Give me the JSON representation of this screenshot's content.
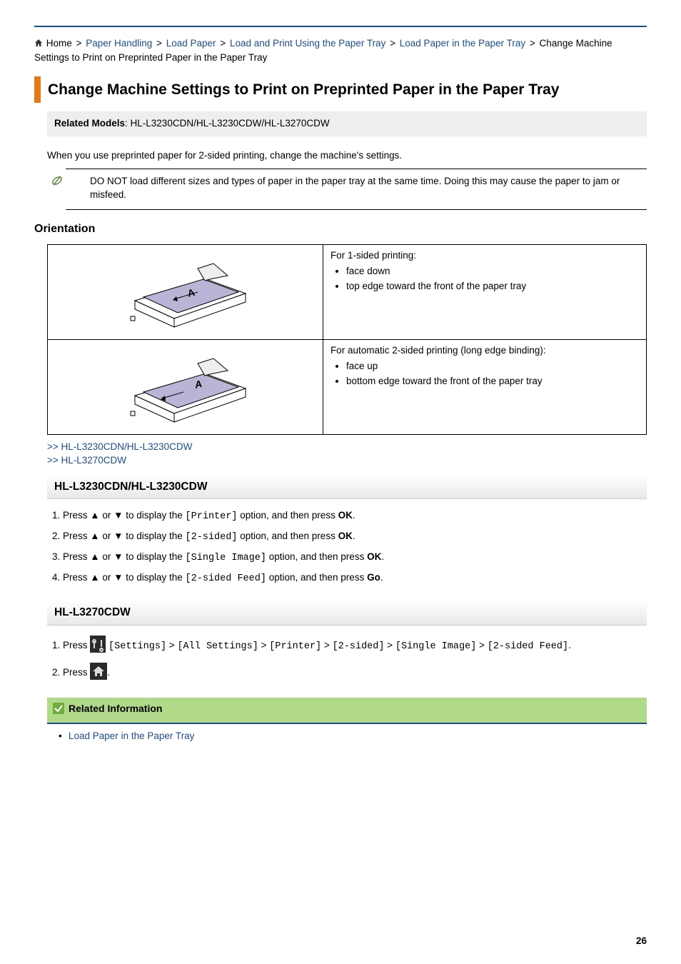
{
  "breadcrumb": {
    "home": "Home",
    "items": [
      "Paper Handling",
      "Load Paper",
      "Load and Print Using the Paper Tray",
      "Load Paper in the Paper Tray"
    ],
    "current": "Change Machine Settings to Print on Preprinted Paper in the Paper Tray"
  },
  "title": "Change Machine Settings to Print on Preprinted Paper in the Paper Tray",
  "related_models": {
    "label": "Related Models",
    "value": ": HL-L3230CDN/HL-L3230CDW/HL-L3270CDW"
  },
  "intro": "When you use preprinted paper for 2-sided printing, change the machine's settings.",
  "note": "DO NOT load different sizes and types of paper in the paper tray at the same time. Doing this may cause the paper to jam or misfeed.",
  "orientation": {
    "heading": "Orientation",
    "row1": {
      "lead": "For 1-sided printing:",
      "b1": "face down",
      "b2": "top edge toward the front of the paper tray"
    },
    "row2": {
      "lead": "For automatic 2-sided printing (long edge binding):",
      "b1": "face up",
      "b2": "bottom edge toward the front of the paper tray"
    }
  },
  "anchors": {
    "a1": ">> HL-L3230CDN/HL-L3230CDW",
    "a2": ">> HL-L3270CDW"
  },
  "section_a": {
    "heading": "HL-L3230CDN/HL-L3230CDW",
    "steps": {
      "s1": {
        "pre": "Press ▲ or ▼ to display the ",
        "code": "[Printer]",
        "mid": " option, and then press ",
        "key": "OK",
        "post": "."
      },
      "s2": {
        "pre": "Press ▲ or ▼ to display the ",
        "code": "[2-sided]",
        "mid": " option, and then press ",
        "key": "OK",
        "post": "."
      },
      "s3": {
        "pre": "Press ▲ or ▼ to display the ",
        "code": "[Single Image]",
        "mid": " option, and then press ",
        "key": "OK",
        "post": "."
      },
      "s4": {
        "pre": "Press ▲ or ▼ to display the ",
        "code": "[2-sided Feed]",
        "mid": " option, and then press ",
        "key": "Go",
        "post": "."
      }
    }
  },
  "section_b": {
    "heading": "HL-L3270CDW",
    "step1": {
      "pre": "Press ",
      "codes": {
        "c1": "[Settings]",
        "c2": "[All Settings]",
        "c3": "[Printer]",
        "c4": "[2-sided]",
        "c5": "[Single Image]",
        "c6": "[2-sided Feed]"
      },
      "sep": " > ",
      "end": "."
    },
    "step2": {
      "pre": "Press ",
      "end": "."
    }
  },
  "related_info": {
    "heading": "Related Information",
    "link": "Load Paper in the Paper Tray"
  },
  "page_number": "26"
}
